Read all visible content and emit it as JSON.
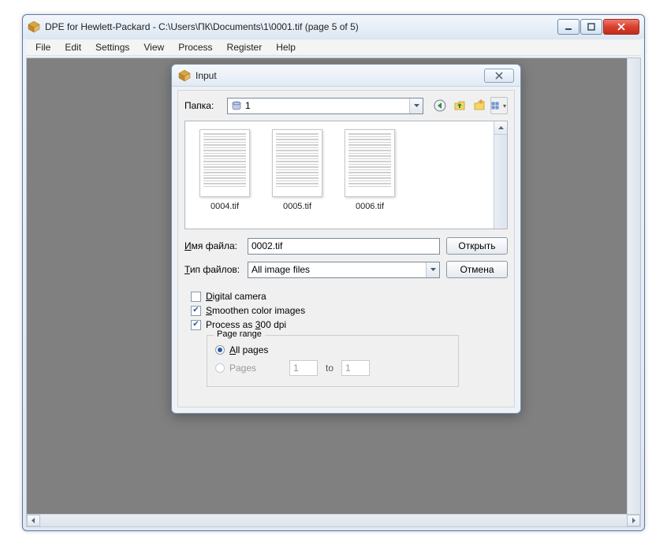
{
  "window": {
    "title": "DPE for Hewlett-Packard - C:\\Users\\ПК\\Documents\\1\\0001.tif (page 5 of 5)"
  },
  "menu": {
    "file": "File",
    "edit": "Edit",
    "settings": "Settings",
    "view": "View",
    "process": "Process",
    "register": "Register",
    "help": "Help"
  },
  "dialog": {
    "title": "Input",
    "folder_label": "Папка:",
    "folder_value": "1",
    "filename_label": "Имя файла:",
    "filename_value": "0002.tif",
    "filetype_label": "Тип файлов:",
    "filetype_value": "All image files",
    "open_button": "Открыть",
    "cancel_button": "Отмена",
    "thumbs": [
      {
        "name": "0004.tif"
      },
      {
        "name": "0005.tif"
      },
      {
        "name": "0006.tif"
      }
    ],
    "opt_digital_camera": "Digital camera",
    "opt_smoothen": "Smoothen color images",
    "opt_300dpi": "Process as 300 dpi",
    "page_range_legend": "Page range",
    "all_pages": "All pages",
    "pages": "Pages",
    "page_from": "1",
    "page_to": "1",
    "to_label": "to"
  }
}
